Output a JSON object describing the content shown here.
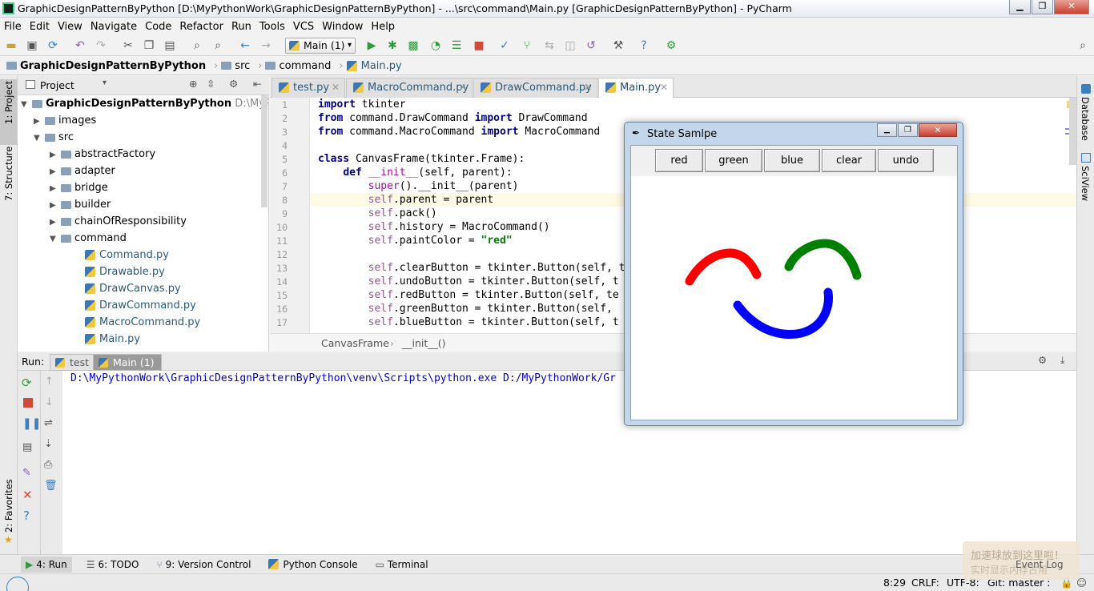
{
  "window": {
    "title": "GraphicDesignPatternByPython [D:\\MyPythonWork\\GraphicDesignPatternByPython] - ...\\src\\command\\Main.py [GraphicDesignPatternByPython] - PyCharm"
  },
  "menu": [
    "File",
    "Edit",
    "View",
    "Navigate",
    "Code",
    "Refactor",
    "Run",
    "Tools",
    "VCS",
    "Window",
    "Help"
  ],
  "toolbar": {
    "run_config": "Main (1)"
  },
  "breadcrumb": [
    "GraphicDesignPatternByPython",
    "src",
    "command",
    "Main.py"
  ],
  "sidebars": {
    "left_top": [
      "1: Project",
      "7: Structure"
    ],
    "left_bottom": "2: Favorites",
    "right": [
      "Database",
      "SciView"
    ]
  },
  "project": {
    "header": "Project",
    "root_name": "GraphicDesignPatternByPython",
    "root_path": "D:\\MyPython",
    "items": [
      {
        "label": "images"
      },
      {
        "label": "src"
      },
      {
        "label": "abstractFactory"
      },
      {
        "label": "adapter"
      },
      {
        "label": "bridge"
      },
      {
        "label": "builder"
      },
      {
        "label": "chainOfResponsibility"
      },
      {
        "label": "command"
      },
      {
        "label": "Command.py"
      },
      {
        "label": "Drawable.py"
      },
      {
        "label": "DrawCanvas.py"
      },
      {
        "label": "DrawCommand.py"
      },
      {
        "label": "MacroCommand.py"
      },
      {
        "label": "Main.py"
      }
    ]
  },
  "editor_tabs": [
    "test.py",
    "MacroCommand.py",
    "DrawCommand.py",
    "Main.py"
  ],
  "code_lines": {
    "l1": "tkinter",
    "l2a": "command.DrawCommand",
    "l2b": "DrawCommand",
    "l3a": "command.MacroCommand",
    "l3b": "MacroCommand",
    "l5": "CanvasFrame(tkinter.Frame):",
    "l6": "(self, parent):",
    "l7": "().__init__(parent)",
    "l8": ".parent = parent",
    "l9": ".pack()",
    "l10": ".history = MacroCommand()",
    "l11a": ".paintColor = ",
    "l11b": "\"red\"",
    "l13": ".clearButton = tkinter.Button(self, t",
    "l14": ".undoButton = tkinter.Button(self, t",
    "l15": ".redButton = tkinter.Button(self, te",
    "l16": ".greenButton = tkinter.Button(self,",
    "l17": ".blueButton = tkinter.Button(self, t"
  },
  "keywords": {
    "import": "import",
    "from": "from",
    "class": "class",
    "def": "def",
    "self": "self",
    "super": "super",
    "init": "__init__"
  },
  "editor_breadcrumb": [
    "CanvasFrame",
    "__init__()"
  ],
  "run_panel": {
    "label": "Run:",
    "tabs": [
      "test",
      "Main (1)"
    ],
    "output": "D:\\MyPythonWork\\GraphicDesignPatternByPython\\venv\\Scripts\\python.exe D:/MyPythonWork/Gr"
  },
  "bottom_tools": [
    "4: Run",
    "6: TODO",
    "9: Version Control",
    "Python Console",
    "Terminal"
  ],
  "status": {
    "position": "8:29",
    "line_sep": "CRLF:",
    "encoding": "UTF-8:",
    "git": "Git: master :",
    "event_log": "Event Log",
    "overlay1": "加速球放到这里啦！",
    "overlay2": "实时显示内存占用"
  },
  "tk_window": {
    "title": "State Samlpe",
    "buttons": [
      "red",
      "green",
      "blue",
      "clear",
      "undo"
    ],
    "strokes": [
      {
        "color": "#ff0000",
        "label": "red"
      },
      {
        "color": "#008000",
        "label": "green"
      },
      {
        "color": "#0000ff",
        "label": "blue"
      }
    ]
  },
  "colors": {
    "keyword": "#000080",
    "string": "#008000",
    "self": "#94558d",
    "magic": "#b200b2",
    "console": "#0000c0"
  }
}
